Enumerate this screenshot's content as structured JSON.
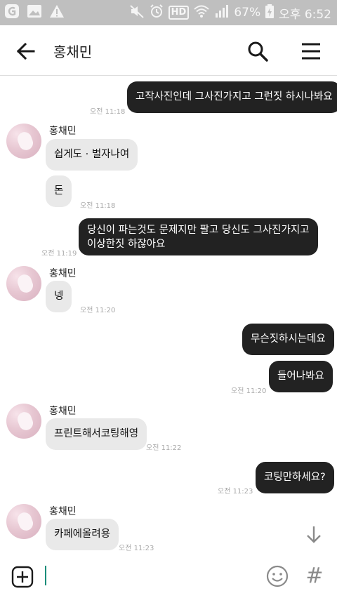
{
  "status_bar": {
    "battery_percent": "67%",
    "time": "오후 6:52",
    "hd_badge": "HD"
  },
  "header": {
    "title": "홍채민"
  },
  "messages": [
    {
      "direction": "out",
      "text": "고작사진인데 그사진가지고 그런짓 하시나봐요",
      "time": "오전 11:18"
    },
    {
      "direction": "in",
      "sender": "홍채민",
      "text": "쉽게도 · 벌자나여"
    },
    {
      "direction": "in",
      "text": "돈",
      "time": "오전 11:18"
    },
    {
      "direction": "out",
      "text_lines": [
        "당신이 파는것도 문제지만 팔고 당신도 그사진가지고",
        "이상한짓 하잖아요"
      ],
      "time": "오전 11:19"
    },
    {
      "direction": "in",
      "sender": "홍채민",
      "text": "넹",
      "time": "오전 11:20"
    },
    {
      "direction": "out",
      "text": "무슨짓하시는데요"
    },
    {
      "direction": "out",
      "text": "들어나봐요",
      "time": "오전 11:20"
    },
    {
      "direction": "in",
      "sender": "홍채민",
      "text": "프린트해서코팅해영",
      "time": "오전 11:22"
    },
    {
      "direction": "out",
      "text": "코팅만하세요?",
      "time": "오전 11:23"
    },
    {
      "direction": "in",
      "sender": "홍채민",
      "text": "카페에올려용",
      "time": "오전 11:23"
    }
  ],
  "composer": {
    "value": "",
    "hash_symbol": "#"
  },
  "colors": {
    "outgoing_bubble": "#222222",
    "incoming_bubble": "#e9e9e9",
    "status_bar": "#bfbfbf",
    "cursor": "#1a8d7a"
  },
  "icons": {
    "back": "arrow-left-icon",
    "search": "search-icon",
    "menu": "hamburger-menu-icon",
    "scroll_down": "arrow-down-icon",
    "add": "plus-square-icon",
    "emoji": "smiley-icon",
    "hash": "hash-icon"
  }
}
